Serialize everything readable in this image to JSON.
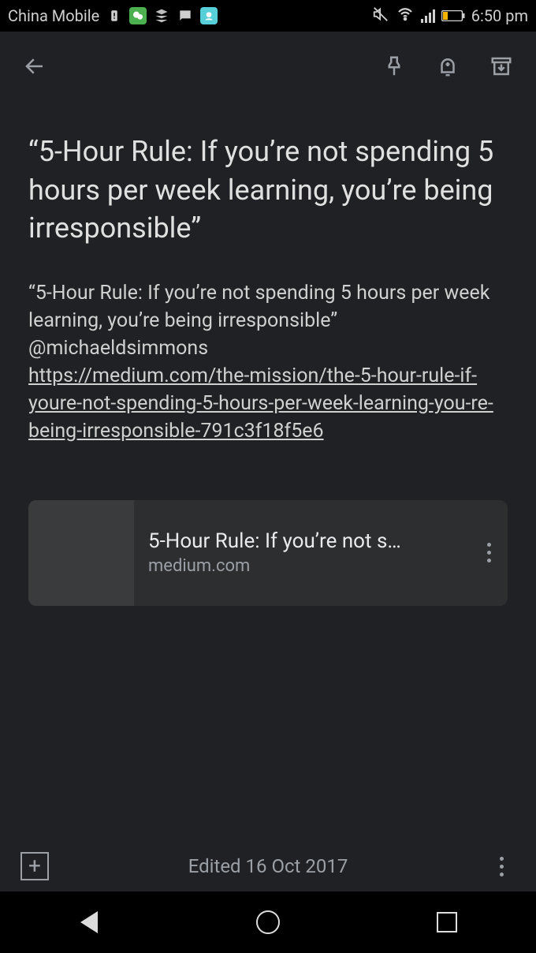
{
  "status": {
    "carrier": "China Mobile",
    "time": "6:50 pm"
  },
  "note": {
    "title": "“5-Hour Rule: If you’re not spending 5 hours per week learning, you’re being irresponsible”",
    "body_text": "“5-Hour Rule: If you’re not spending 5 hours per week learning, you’re being irresponsible” @michaeldsimmons",
    "link_url": "https://medium.com/the-mission/the-5-hour-rule-if-youre-not-spending-5-hours-per-week-learning-you-re-being-irresponsible-791c3f18f5e6"
  },
  "link_card": {
    "title": "5-Hour Rule: If you’re not s…",
    "domain": "medium.com"
  },
  "footer": {
    "edited": "Edited 16 Oct 2017"
  }
}
